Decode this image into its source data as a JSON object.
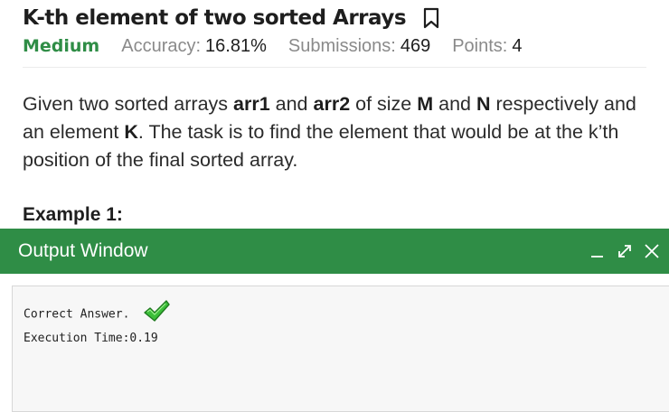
{
  "problem": {
    "title": "K-th element of two sorted Arrays",
    "difficulty": "Medium",
    "accuracy_label": "Accuracy:",
    "accuracy_value": "16.81%",
    "submissions_label": "Submissions:",
    "submissions_value": "469",
    "points_label": "Points:",
    "points_value": "4",
    "description": {
      "p1": "Given two sorted arrays ",
      "arr1": "arr1",
      "p2": " and ",
      "arr2": "arr2",
      "p3": " of size ",
      "m": "M",
      "p4": " and ",
      "n": "N",
      "p5": " respectively and an element ",
      "k": "K",
      "p6": ". The task is to find the element that would be at the k’th position of the final sorted array."
    },
    "example_heading": "Example 1:"
  },
  "output_window": {
    "title": "Output Window",
    "result_text": "Correct Answer.",
    "execution_time": "Execution Time:0.19"
  },
  "icons": {
    "bookmark": "bookmark-icon",
    "minimize": "minimize-icon",
    "expand": "expand-icon",
    "close": "close-icon",
    "check": "checkmark-icon"
  },
  "colors": {
    "brand_green": "#2f8d46",
    "muted": "#8a8a8a"
  }
}
